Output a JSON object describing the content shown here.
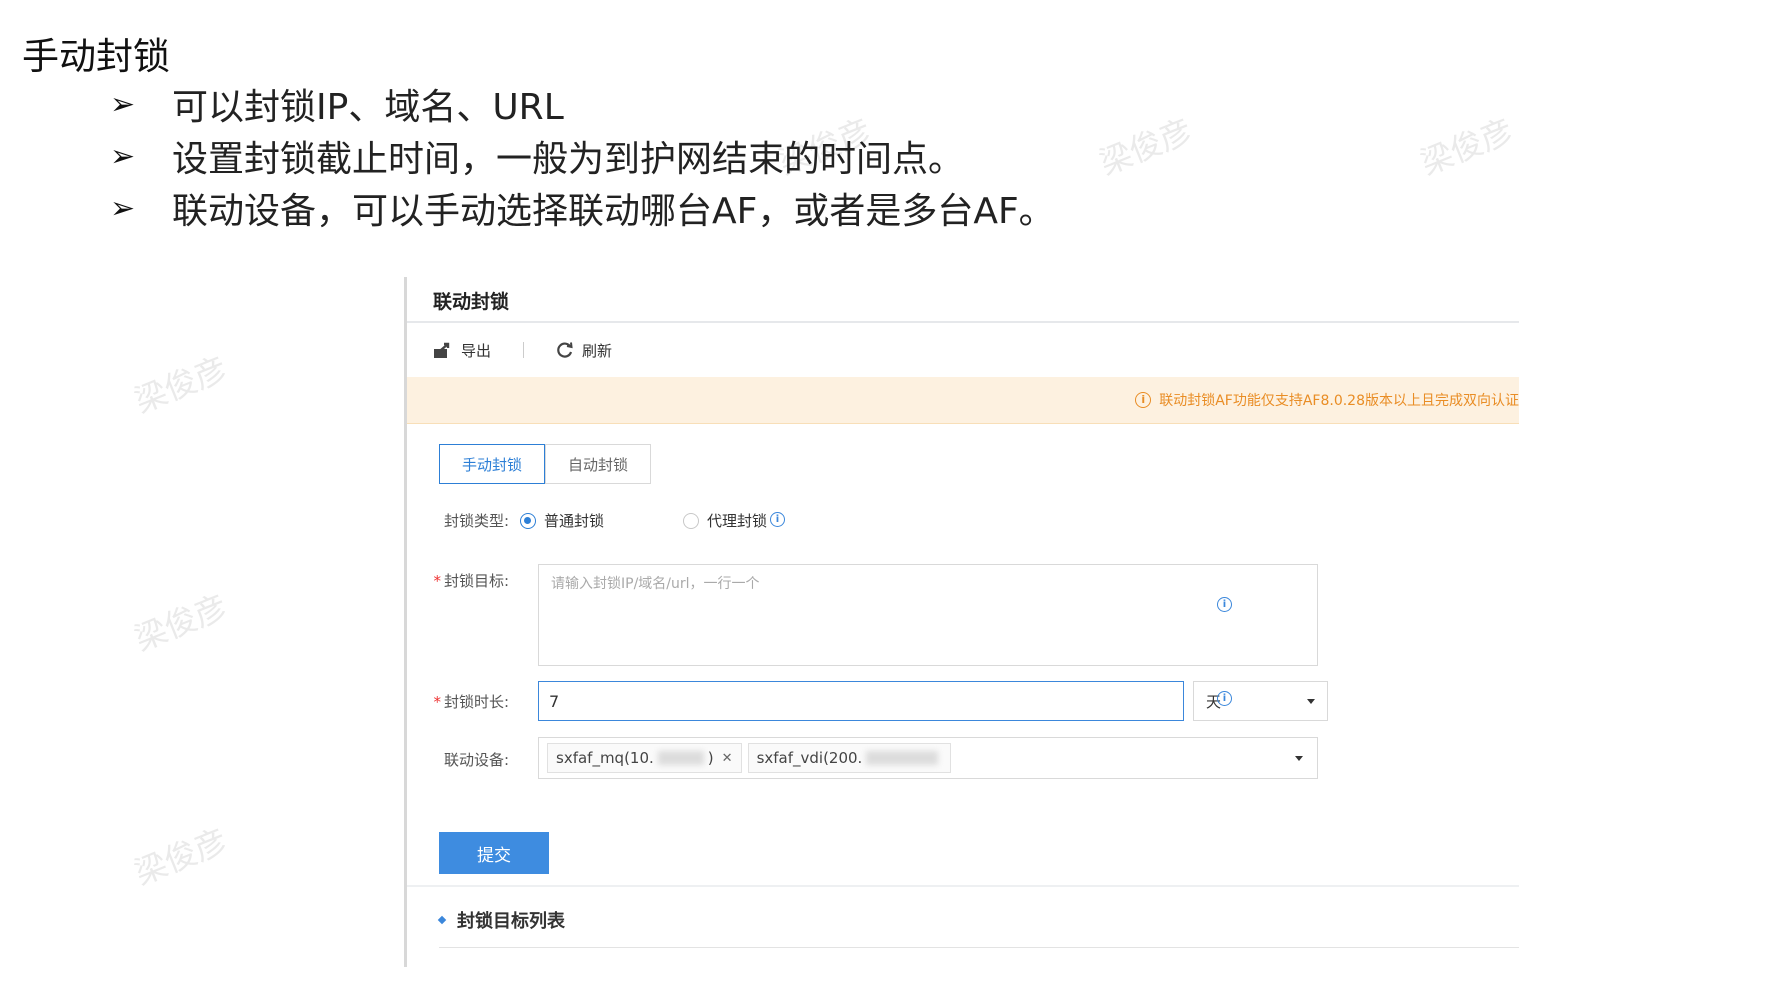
{
  "slide": {
    "title": "手动封锁",
    "bullets": [
      "可以封锁IP、域名、URL",
      "设置封锁截止时间，一般为到护网结束的时间点。",
      "联动设备，可以手动选择联动哪台AF，或者是多台AF。"
    ],
    "bullet_icon": "arrow-right-icon",
    "watermark": "梁俊彦"
  },
  "panel": {
    "title": "联动封锁",
    "toolbar": {
      "export_label": "导出",
      "refresh_label": "刷新"
    },
    "notice": "联动封锁AF功能仅支持AF8.0.28版本以上且完成双向认证",
    "tabs": [
      {
        "label": "手动封锁",
        "active": true
      },
      {
        "label": "自动封锁",
        "active": false
      }
    ],
    "block_type": {
      "label": "封锁类型:",
      "options": [
        "普通封锁",
        "代理封锁"
      ],
      "selected": "普通封锁"
    },
    "target": {
      "label": "封锁目标:",
      "placeholder": "请输入封锁IP/域名/url，一行一个"
    },
    "duration": {
      "label": "封锁时长:",
      "value": "7",
      "unit": "天"
    },
    "devices": {
      "label": "联动设备:",
      "chips": [
        "sxfaf_mq(10.",
        "sxfaf_vdi(200."
      ],
      "chip_suffix_1": ")"
    },
    "submit_label": "提交",
    "list_title": "封锁目标列表"
  },
  "colors": {
    "primary": "#3e8ce0",
    "notice_bg": "#fdf1e0",
    "notice_text": "#e98d25",
    "required": "#e33333"
  }
}
